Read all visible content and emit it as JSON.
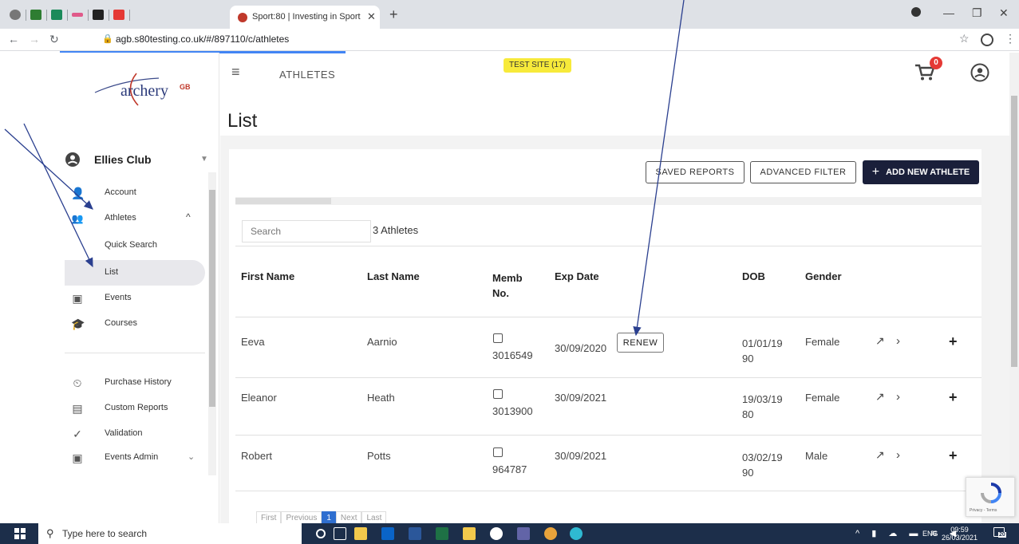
{
  "browser": {
    "tab_title": "Sport:80 | Investing in Sport",
    "url": "agb.s80testing.co.uk/#/897110/c/athletes"
  },
  "app": {
    "section_title": "ATHLETES",
    "test_badge": "TEST SITE (17)",
    "cart_count": "0",
    "page_title": "List",
    "brand": "archery",
    "brand_suffix": "GB"
  },
  "sidebar": {
    "club_name": "Ellies Club",
    "items": [
      {
        "label": "Account",
        "icon": "person-icon"
      },
      {
        "label": "Athletes",
        "icon": "people-icon"
      },
      {
        "label": "Quick Search",
        "icon": ""
      },
      {
        "label": "List",
        "icon": ""
      },
      {
        "label": "Events",
        "icon": "calendar-icon"
      },
      {
        "label": "Courses",
        "icon": "mortarboard-icon"
      },
      {
        "label": "Purchase History",
        "icon": "history-icon"
      },
      {
        "label": "Custom Reports",
        "icon": "report-icon"
      },
      {
        "label": "Validation",
        "icon": "check-circle-icon"
      },
      {
        "label": "Events Admin",
        "icon": "calendar-admin-icon"
      }
    ]
  },
  "toolbar": {
    "saved_reports": "SAVED REPORTS",
    "advanced_filter": "ADVANCED FILTER",
    "add_new": "ADD NEW ATHLETE"
  },
  "table": {
    "search_placeholder": "Search",
    "count_label": "3 Athletes",
    "headers": [
      "First Name",
      "Last Name",
      "Memb\nNo.",
      "Exp Date",
      "DOB",
      "Gender"
    ],
    "renew_label": "RENEW",
    "rows": [
      {
        "first": "Eeva",
        "last": "Aarnio",
        "memb": "3016549",
        "exp": "30/09/2020",
        "dob": "01/01/19\n90",
        "gender": "Female"
      },
      {
        "first": "Eleanor",
        "last": "Heath",
        "memb": "3013900",
        "exp": "30/09/2021",
        "dob": "19/03/19\n80",
        "gender": "Female"
      },
      {
        "first": "Robert",
        "last": "Potts",
        "memb": "964787",
        "exp": "30/09/2021",
        "dob": "03/02/19\n90",
        "gender": "Male"
      }
    ]
  },
  "pager": {
    "first": "First",
    "previous": "Previous",
    "current": "1",
    "next": "Next",
    "last": "Last"
  },
  "recaptcha": {
    "text": "Privacy - Terms"
  },
  "taskbar": {
    "search_placeholder": "Type here to search",
    "lang": "ENG",
    "time": "09:59",
    "date": "26/03/2021",
    "notif_count": "20"
  }
}
